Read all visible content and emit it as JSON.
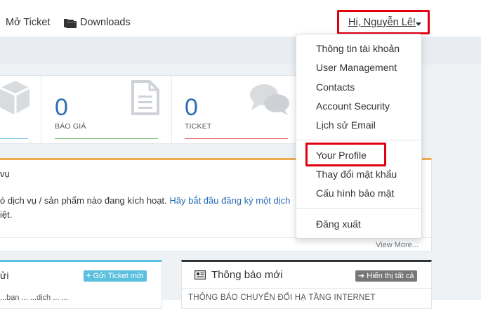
{
  "nav": {
    "open_ticket": "Mở Ticket",
    "downloads": "Downloads",
    "greeting": "Hi, Nguyễn Lê!"
  },
  "stats": [
    {
      "value": "0",
      "label": "BÁO GIÁ",
      "icon": "document-icon",
      "color": "#5cb85c"
    },
    {
      "value": "0",
      "label": "TICKET",
      "icon": "chat-bubbles-icon",
      "color": "#d9534f"
    }
  ],
  "services": {
    "title": "vụ",
    "text_before": "ó dịch vụ / sản phẩm nào đang kích hoạt. ",
    "link": "Hãy bắt đầu đăng ký một dịch",
    "text_line2": "iệt.",
    "view_more": "View More..."
  },
  "tickets": {
    "title": "ửi",
    "button": "Gửi Ticket mới",
    "sub": "...bạn ... ...dịch ... ..."
  },
  "announcements": {
    "title": "Thông báo mới",
    "button": "Hiển thị tất cả",
    "item": "THÔNG BÁO CHUYỂN ĐỔI HẠ TẦNG INTERNET"
  },
  "account_menu": {
    "items": [
      "Thông tin tài khoản",
      "User Management",
      "Contacts",
      "Account Security",
      "Lịch sử Email",
      "Your Profile",
      "Thay đổi mật khẩu",
      "Cấu hình bảo mật",
      "Đăng xuất"
    ]
  },
  "colors": {
    "accent_blue": "#2b6db0",
    "highlight_red": "#e0000f",
    "warning_orange": "#f0ad4e",
    "info_cyan": "#5bc0de"
  }
}
